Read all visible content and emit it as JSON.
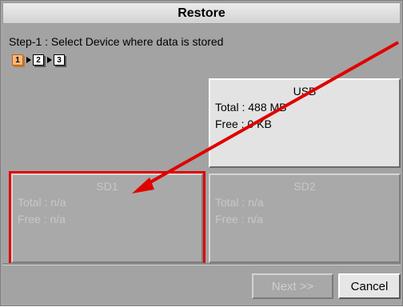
{
  "dialog": {
    "title": "Restore",
    "step_text": "Step-1 : Select Device where data is stored",
    "steps": [
      "1",
      "2",
      "3"
    ]
  },
  "devices": [
    {
      "name": "USB",
      "total": "Total : 488 MB",
      "free": "Free : 0 KB",
      "enabled": true
    },
    {
      "name": "SD1",
      "total": "Total : n/a",
      "free": "Free : n/a",
      "enabled": false
    },
    {
      "name": "SD2",
      "total": "Total : n/a",
      "free": "Free : n/a",
      "enabled": false
    }
  ],
  "buttons": {
    "next": "Next >>",
    "cancel": "Cancel"
  },
  "colors": {
    "annotation": "#e00000",
    "panel": "#a3a3a3"
  }
}
